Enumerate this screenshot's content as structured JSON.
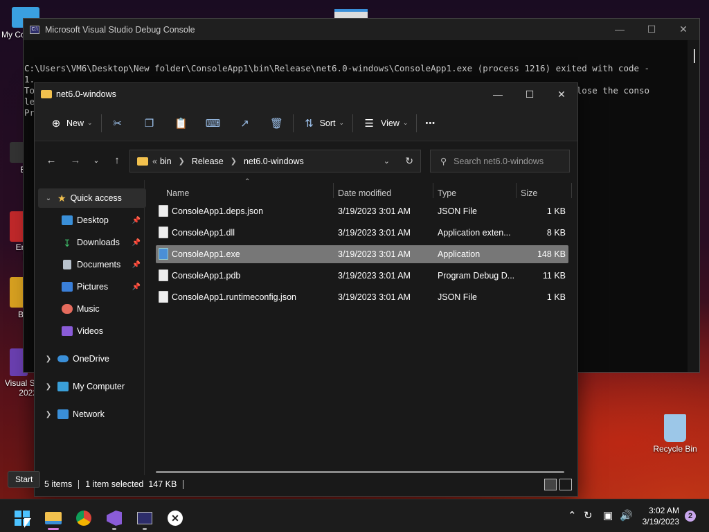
{
  "desktop": {
    "icons": [
      {
        "label": "My Co"
      },
      {
        "label": "Ever"
      },
      {
        "label": "Emba\nDev"
      },
      {
        "label": "Bad I"
      },
      {
        "label": "Visual St\n2022"
      },
      {
        "label": "Recycle Bin"
      }
    ]
  },
  "console": {
    "title": "Microsoft Visual Studio Debug Console",
    "lines": [
      "C:\\Users\\VM6\\Desktop\\New folder\\ConsoleApp1\\bin\\Release\\net6.0-windows\\ConsoleApp1.exe (process 1216) exited with code -",
      "1.",
      "To automatically close the console when debugging stops, enable Tools->Options->Debugging->Automatically close the conso",
      "le",
      "Pr"
    ]
  },
  "explorer": {
    "title": "net6.0-windows",
    "commands": {
      "new": "New",
      "sort": "Sort",
      "view": "View",
      "more": "•••"
    },
    "breadcrumb": [
      "bin",
      "Release",
      "net6.0-windows"
    ],
    "breadcrumb_prefix": "«",
    "search_placeholder": "Search net6.0-windows",
    "nav": [
      {
        "label": "Quick access",
        "icon": "star-icon",
        "color": "#f2c14e"
      },
      {
        "label": "Desktop",
        "icon": "desktop-icon",
        "color": "#3a8fd8"
      },
      {
        "label": "Downloads",
        "icon": "download-icon",
        "color": "#3fbf6a"
      },
      {
        "label": "Documents",
        "icon": "document-icon",
        "color": "#b8c2cc"
      },
      {
        "label": "Pictures",
        "icon": "pictures-icon",
        "color": "#3a7fd8"
      },
      {
        "label": "Music",
        "icon": "music-icon",
        "color": "#e56b5d"
      },
      {
        "label": "Videos",
        "icon": "videos-icon",
        "color": "#8a5cd8"
      },
      {
        "label": "OneDrive",
        "icon": "onedrive-icon",
        "color": "#3a8fd8"
      },
      {
        "label": "My Computer",
        "icon": "computer-icon",
        "color": "#3a9fd8"
      },
      {
        "label": "Network",
        "icon": "network-icon",
        "color": "#3a8fd8"
      }
    ],
    "columns": {
      "name": "Name",
      "date": "Date modified",
      "type": "Type",
      "size": "Size"
    },
    "files": [
      {
        "name": "ConsoleApp1.deps.json",
        "date": "3/19/2023 3:01 AM",
        "type": "JSON File",
        "size": "1 KB",
        "selected": false
      },
      {
        "name": "ConsoleApp1.dll",
        "date": "3/19/2023 3:01 AM",
        "type": "Application exten...",
        "size": "8 KB",
        "selected": false
      },
      {
        "name": "ConsoleApp1.exe",
        "date": "3/19/2023 3:01 AM",
        "type": "Application",
        "size": "148 KB",
        "selected": true
      },
      {
        "name": "ConsoleApp1.pdb",
        "date": "3/19/2023 3:01 AM",
        "type": "Program Debug D...",
        "size": "11 KB",
        "selected": false
      },
      {
        "name": "ConsoleApp1.runtimeconfig.json",
        "date": "3/19/2023 3:01 AM",
        "type": "JSON File",
        "size": "1 KB",
        "selected": false
      }
    ],
    "status": {
      "items": "5 items",
      "selected": "1 item selected  147 KB"
    }
  },
  "taskbar": {
    "tooltip": "Start",
    "time": "3:02 AM",
    "date": "3/19/2023",
    "notifications": "2"
  }
}
